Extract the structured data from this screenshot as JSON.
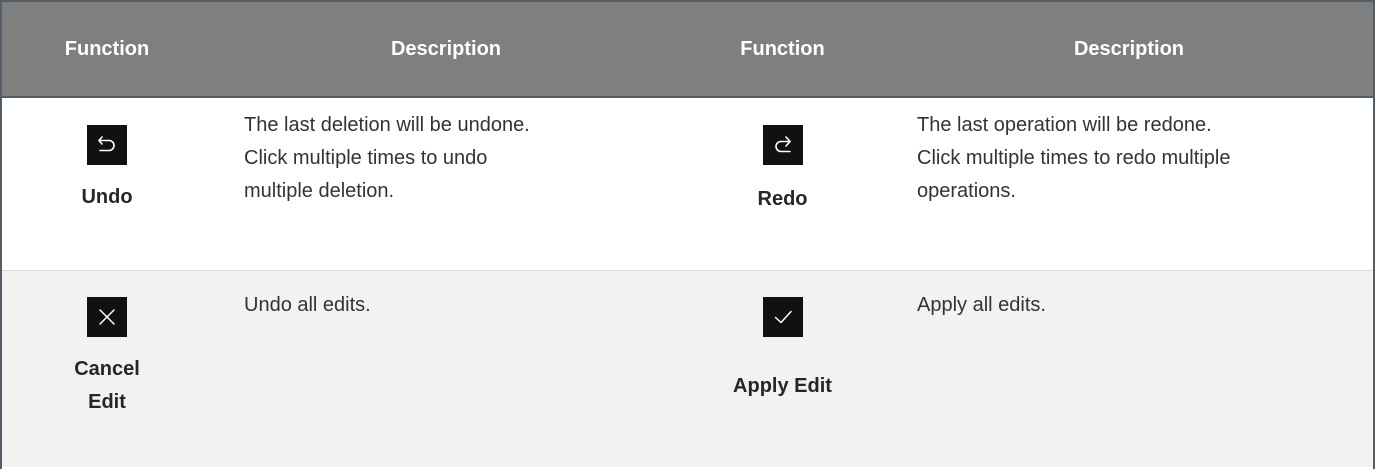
{
  "header": {
    "col1": "Function",
    "col2": "Description",
    "col3": "Function",
    "col4": "Description"
  },
  "rows": [
    {
      "left": {
        "icon": "undo-icon",
        "label": "Undo",
        "description_lines": [
          "The last deletion will be undone.",
          "Click multiple times to undo",
          "multiple deletion."
        ]
      },
      "right": {
        "icon": "redo-icon",
        "label": "Redo",
        "description_lines": [
          "The last operation will be redone.",
          "Click multiple times to redo multiple",
          "operations."
        ]
      }
    },
    {
      "left": {
        "icon": "close-icon",
        "label_lines": [
          "Cancel",
          "Edit"
        ],
        "description": "Undo all edits."
      },
      "right": {
        "icon": "check-icon",
        "label": "Apply Edit",
        "description": "Apply all edits."
      }
    }
  ],
  "colors": {
    "header_bg": "#7f7f7f",
    "header_text": "#ffffff",
    "row_alt_bg": "#f2f2f2",
    "icon_bg": "#111111",
    "border": "#555d66"
  }
}
